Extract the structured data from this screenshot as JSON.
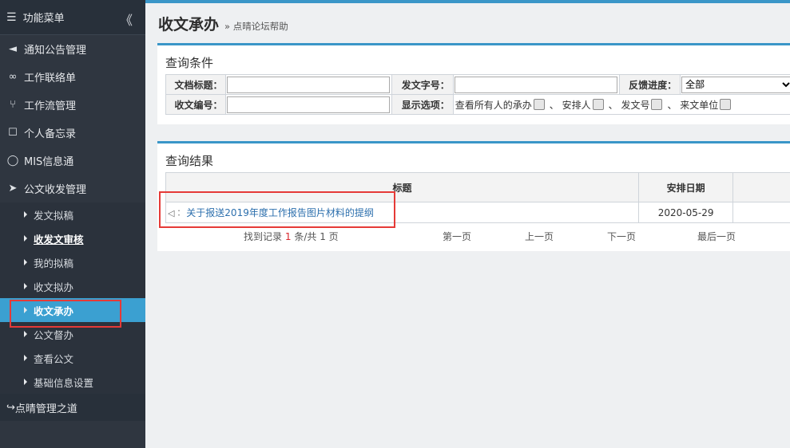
{
  "sidebar": {
    "header": {
      "label": "功能菜单",
      "collapse_glyph": "《"
    },
    "items": [
      {
        "label": "通知公告管理",
        "icon": "megaphone-icon",
        "glyph": "📢"
      },
      {
        "label": "工作联络单",
        "icon": "handshake-icon",
        "glyph": "⚭"
      },
      {
        "label": "工作流管理",
        "icon": "workflow-icon",
        "glyph": "⑂"
      },
      {
        "label": "个人备忘录",
        "icon": "bookmark-icon",
        "glyph": "🔖"
      },
      {
        "label": "MIS信息通",
        "icon": "chat-icon",
        "glyph": "💬"
      },
      {
        "label": "公文收发管理",
        "icon": "send-icon",
        "glyph": "✈"
      }
    ],
    "sub_items": [
      {
        "label": "发文拟稿"
      },
      {
        "label": "收发文审核"
      },
      {
        "label": "我的拟稿"
      },
      {
        "label": "收文拟办"
      },
      {
        "label": "收文承办"
      },
      {
        "label": "公文督办"
      },
      {
        "label": "查看公文"
      },
      {
        "label": "基础信息设置"
      }
    ],
    "footer": {
      "label": "点晴管理之道",
      "icon": "share-icon",
      "glyph": "↪"
    }
  },
  "header": {
    "title": "收文承办",
    "help_link": "» 点晴论坛帮助"
  },
  "query": {
    "title": "查询条件",
    "doc_title_label": "文档标题：",
    "doc_title_value": "",
    "doc_no_label": "发文字号：",
    "doc_no_value": "",
    "progress_label": "反馈进度：",
    "progress_value": "全部",
    "recv_no_label": "收文编号：",
    "recv_no_value": "",
    "display_label": "显示选项：",
    "options": [
      "查看所有人的承办",
      "、 安排人",
      "、 发文号",
      "、 来文单位"
    ]
  },
  "results": {
    "title": "查询结果",
    "columns": [
      "标题",
      "安排日期"
    ],
    "rows": [
      {
        "icon": "speaker-icon",
        "title": "关于报送2019年度工作报告图片材料的提纲",
        "date": "2020-05-29"
      }
    ],
    "pager": {
      "found_prefix": "找到记录",
      "count": "1",
      "found_mid": "条/共",
      "pages": "1",
      "found_suffix": "页",
      "first": "第一页",
      "prev": "上一页",
      "next": "下一页",
      "last": "最后一页"
    }
  },
  "colors": {
    "sidebar_bg": "#2f3640",
    "active_bg": "#3ba0d1",
    "accent": "#3a96c8",
    "highlight_box": "#e53a37",
    "link": "#2c6fad"
  }
}
